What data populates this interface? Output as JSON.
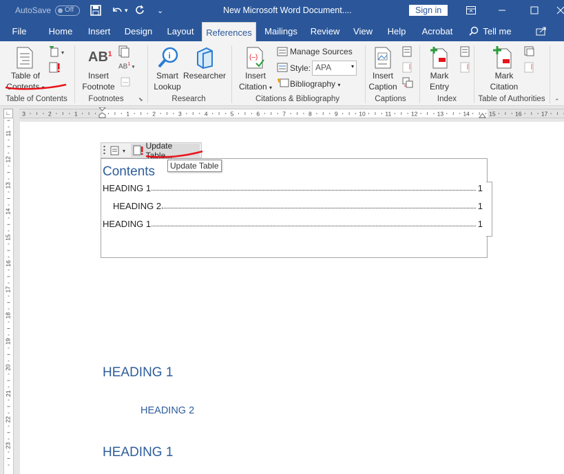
{
  "titlebar": {
    "autosave_label": "AutoSave",
    "autosave_state": "Off",
    "title": "New Microsoft Word Document....",
    "sign_in": "Sign in"
  },
  "tabs": [
    "File",
    "Home",
    "Insert",
    "Design",
    "Layout",
    "References",
    "Mailings",
    "Review",
    "View",
    "Help",
    "Acrobat"
  ],
  "active_tab": "References",
  "tell_me": "Tell me",
  "ribbon": {
    "toc": {
      "line1": "Table of",
      "line2": "Contents",
      "group": "Table of Contents"
    },
    "footnote": {
      "line1": "Insert",
      "line2": "Footnote",
      "group": "Footnotes"
    },
    "research": {
      "smart1": "Smart",
      "smart2": "Lookup",
      "researcher": "Researcher",
      "group": "Research"
    },
    "citations": {
      "insert1": "Insert",
      "insert2": "Citation",
      "manage_sources": "Manage Sources",
      "style_label": "Style:",
      "style_value": "APA",
      "bibliography": "Bibliography",
      "group": "Citations & Bibliography"
    },
    "captions": {
      "line1": "Insert",
      "line2": "Caption",
      "group": "Captions"
    },
    "index": {
      "line1": "Mark",
      "line2": "Entry",
      "group": "Index"
    },
    "authorities": {
      "line1": "Mark",
      "line2": "Citation",
      "group": "Table of Authorities"
    }
  },
  "ruler_h": [
    "3",
    "2",
    "1",
    "1",
    "2",
    "3",
    "4",
    "5",
    "6",
    "7",
    "8",
    "9",
    "10",
    "11",
    "12",
    "13",
    "14",
    "15",
    "16",
    "17"
  ],
  "ruler_v": [
    "11",
    "12",
    "13",
    "14",
    "15",
    "16",
    "17",
    "18",
    "19",
    "20",
    "21",
    "22",
    "23"
  ],
  "toc_toolbar": {
    "update_label": "Update Table..."
  },
  "tooltip": "Update Table",
  "toc": {
    "title": "Contents",
    "entries": [
      {
        "text": "HEADING 1",
        "page": "1"
      },
      {
        "text": "HEADING 2",
        "page": "1"
      },
      {
        "text": "HEADING 1",
        "page": "1"
      }
    ]
  },
  "body_headings": [
    "HEADING 1",
    "HEADING 2",
    "HEADING 1"
  ],
  "colors": {
    "brand": "#2b579a",
    "heading": "#2e5d9b",
    "annotation": "#e8141b"
  }
}
